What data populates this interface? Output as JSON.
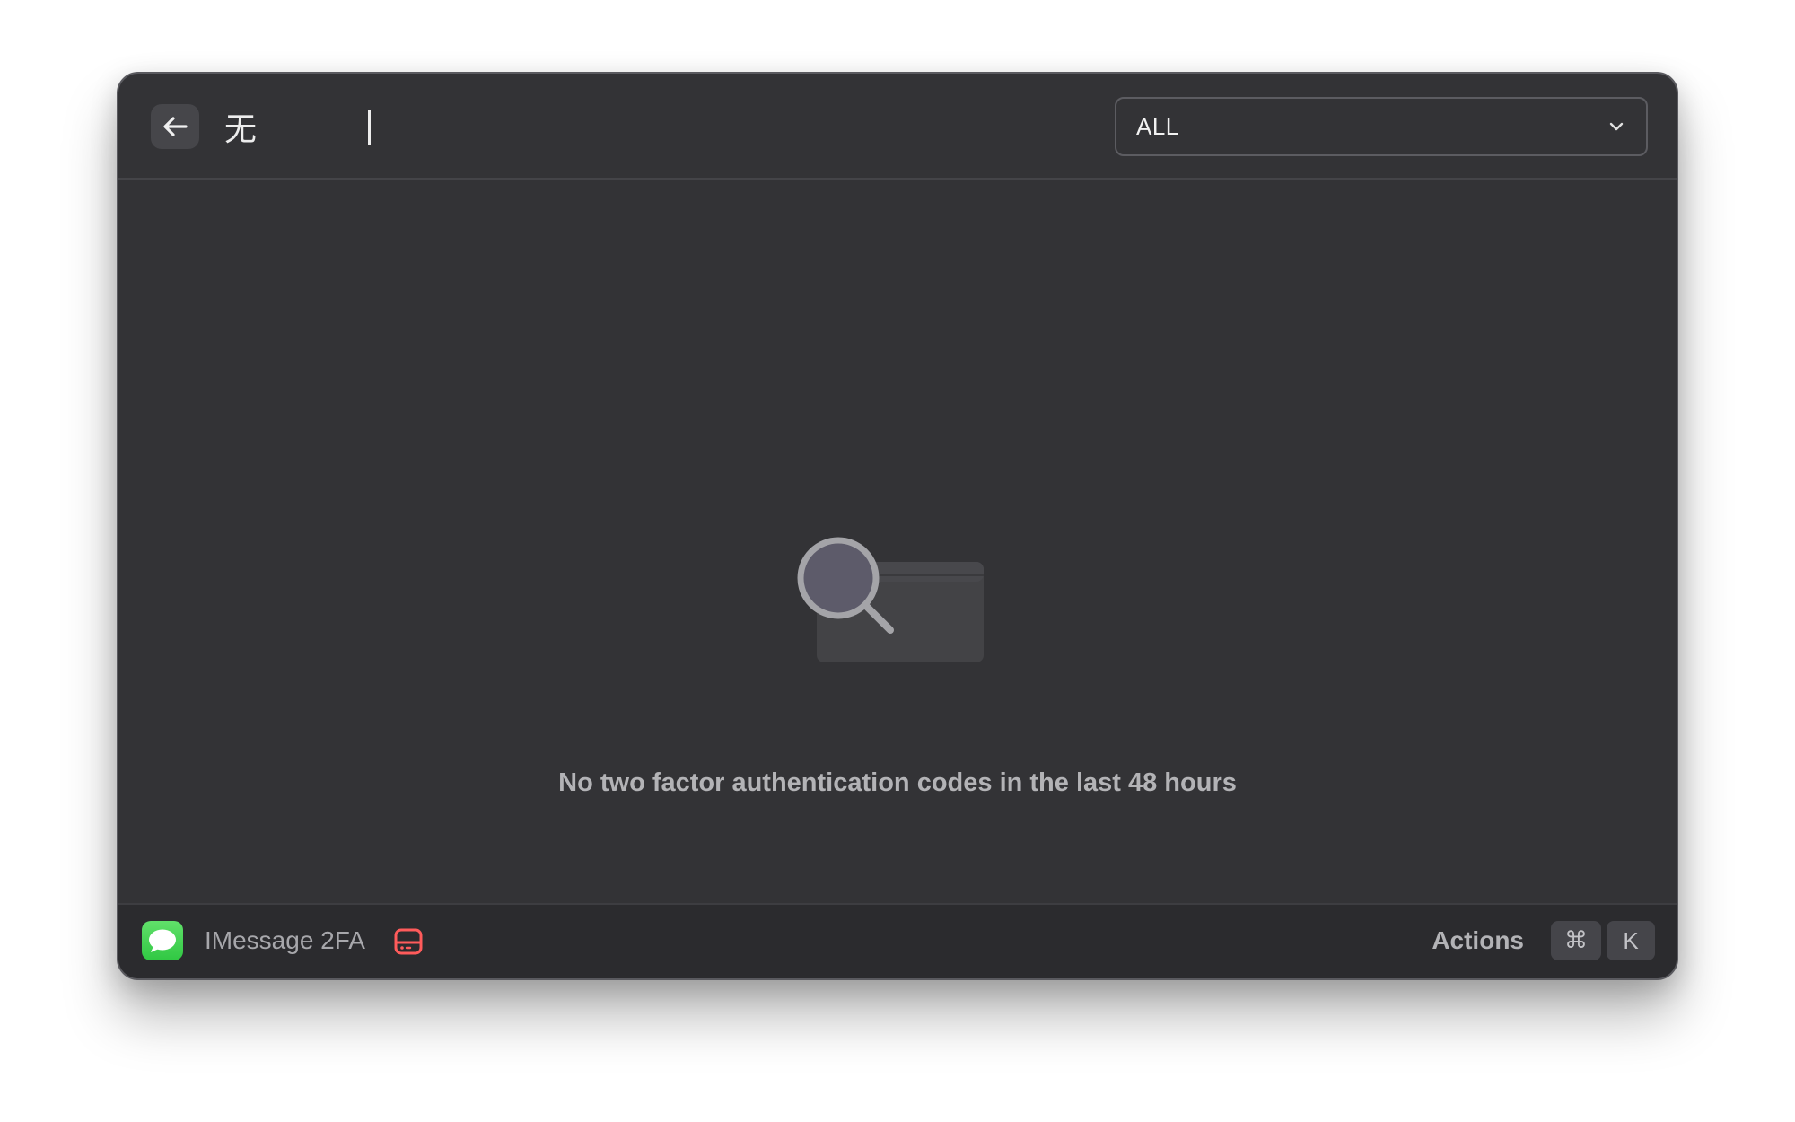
{
  "header": {
    "back_button_label": "Back",
    "search_query": "无",
    "filter": {
      "selected": "ALL",
      "icon": "chevron-down-icon"
    }
  },
  "empty_state": {
    "icon": "magnifier-over-window-icon",
    "message": "No two factor authentication codes in the last 48 hours"
  },
  "footer": {
    "app_icon": "messages-icon",
    "app_title": "IMessage 2FA",
    "status_icon": "hard-drive-icon",
    "actions_label": "Actions",
    "shortcut_keys": [
      "⌘",
      "K"
    ]
  },
  "colors": {
    "window_bg": "#333336",
    "footer_bg": "#2b2b2e",
    "messages_green": "#30c843",
    "status_red": "#ff5b5b",
    "text_primary": "#ededed",
    "text_secondary": "#b3b3b6"
  }
}
